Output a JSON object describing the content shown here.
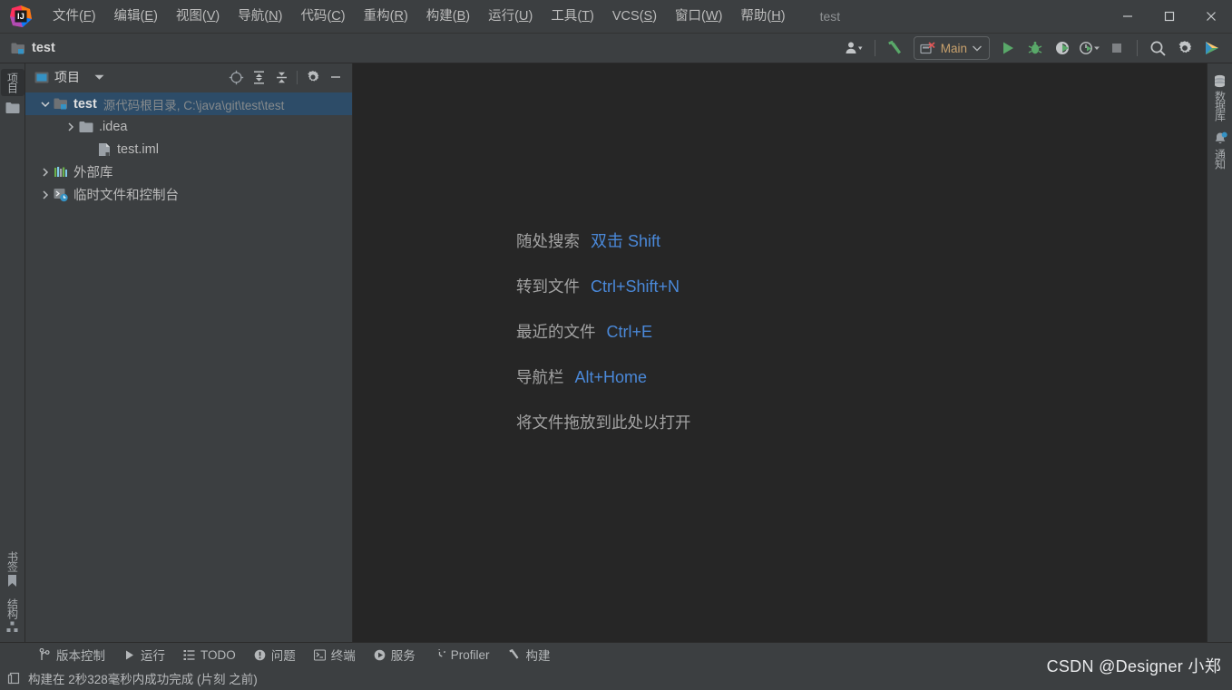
{
  "window": {
    "app_title": "test",
    "minimize_label": "—",
    "maximize_label": "□",
    "close_label": "×"
  },
  "menubar": {
    "items": [
      {
        "text": "文件",
        "mnemonic": "F"
      },
      {
        "text": "编辑",
        "mnemonic": "E"
      },
      {
        "text": "视图",
        "mnemonic": "V"
      },
      {
        "text": "导航",
        "mnemonic": "N"
      },
      {
        "text": "代码",
        "mnemonic": "C"
      },
      {
        "text": "重构",
        "mnemonic": "R"
      },
      {
        "text": "构建",
        "mnemonic": "B"
      },
      {
        "text": "运行",
        "mnemonic": "U"
      },
      {
        "text": "工具",
        "mnemonic": "T"
      },
      {
        "text": "VCS",
        "mnemonic": "S"
      },
      {
        "text": "窗口",
        "mnemonic": "W"
      },
      {
        "text": "帮助",
        "mnemonic": "H"
      }
    ]
  },
  "toolbar": {
    "project_name": "test",
    "run_config": "Main",
    "icons": [
      "user-account-icon",
      "build-hammer-icon",
      "run-icon",
      "debug-icon",
      "run-coverage-icon",
      "run-profiler-icon",
      "stop-icon",
      "search-icon",
      "settings-gear-icon",
      "updates-icon"
    ]
  },
  "left_stripe": {
    "top": [
      {
        "name": "项目",
        "icon": "project-icon",
        "active": true
      },
      {
        "name": "",
        "icon": "folder-icon",
        "active": false
      }
    ],
    "bottom": [
      {
        "name": "书签",
        "icon": "bookmark-icon"
      },
      {
        "name": "结构",
        "icon": "structure-icon"
      }
    ]
  },
  "right_stripe": {
    "items": [
      {
        "name": "数据库",
        "icon": "database-icon"
      },
      {
        "name": "通知",
        "icon": "notifications-bell-icon"
      }
    ]
  },
  "project_panel": {
    "title": "项目",
    "toolbar_icons": [
      "locate-target-icon",
      "expand-all-icon",
      "collapse-all-icon",
      "settings-gear-icon",
      "hide-minimize-icon"
    ],
    "tree": [
      {
        "label": "test",
        "sub": "源代码根目录, C:\\java\\git\\test\\test",
        "icon": "module-folder-icon",
        "indent": 0,
        "twisty": "expanded",
        "bold": true,
        "selected": true
      },
      {
        "label": ".idea",
        "sub": "",
        "icon": "folder-icon",
        "indent": 1,
        "twisty": "collapsed",
        "bold": false,
        "selected": false
      },
      {
        "label": "test.iml",
        "sub": "",
        "icon": "iml-file-icon",
        "indent": 1,
        "twisty": "none",
        "bold": false,
        "selected": false
      },
      {
        "label": "外部库",
        "sub": "",
        "icon": "external-libraries-icon",
        "indent": 0,
        "twisty": "collapsed",
        "bold": false,
        "selected": false
      },
      {
        "label": "临时文件和控制台",
        "sub": "",
        "icon": "scratches-consoles-icon",
        "indent": 0,
        "twisty": "collapsed",
        "bold": false,
        "selected": false
      }
    ]
  },
  "editor": {
    "hints": [
      {
        "text": "随处搜索",
        "shortcut": "双击 Shift"
      },
      {
        "text": "转到文件",
        "shortcut": "Ctrl+Shift+N"
      },
      {
        "text": "最近的文件",
        "shortcut": "Ctrl+E"
      },
      {
        "text": "导航栏",
        "shortcut": "Alt+Home"
      },
      {
        "text": "将文件拖放到此处以打开",
        "shortcut": ""
      }
    ]
  },
  "toolwindow_bar": {
    "items": [
      {
        "label": "版本控制",
        "icon": "vcs-branch-icon"
      },
      {
        "label": "运行",
        "icon": "run-icon"
      },
      {
        "label": "TODO",
        "icon": "todo-list-icon"
      },
      {
        "label": "问题",
        "icon": "problems-icon"
      },
      {
        "label": "终端",
        "icon": "terminal-icon"
      },
      {
        "label": "服务",
        "icon": "services-icon"
      },
      {
        "label": "Profiler",
        "icon": "profiler-icon"
      },
      {
        "label": "构建",
        "icon": "build-hammer-icon"
      }
    ]
  },
  "statusbar": {
    "icon": "memory-indicator-icon",
    "message": "构建在 2秒328毫秒内成功完成 (片刻 之前)"
  },
  "watermark": {
    "text": "CSDN @Designer 小郑"
  },
  "colors": {
    "panel_bg": "#3c3f41",
    "editor_bg": "#262626",
    "selection_blue": "#2d4c68",
    "accent_link": "#4a88d8",
    "text_primary": "#bbbbbb",
    "text_dim": "#868a8c",
    "run_green": "#59a869",
    "runcfg_text": "#c9a26d"
  }
}
